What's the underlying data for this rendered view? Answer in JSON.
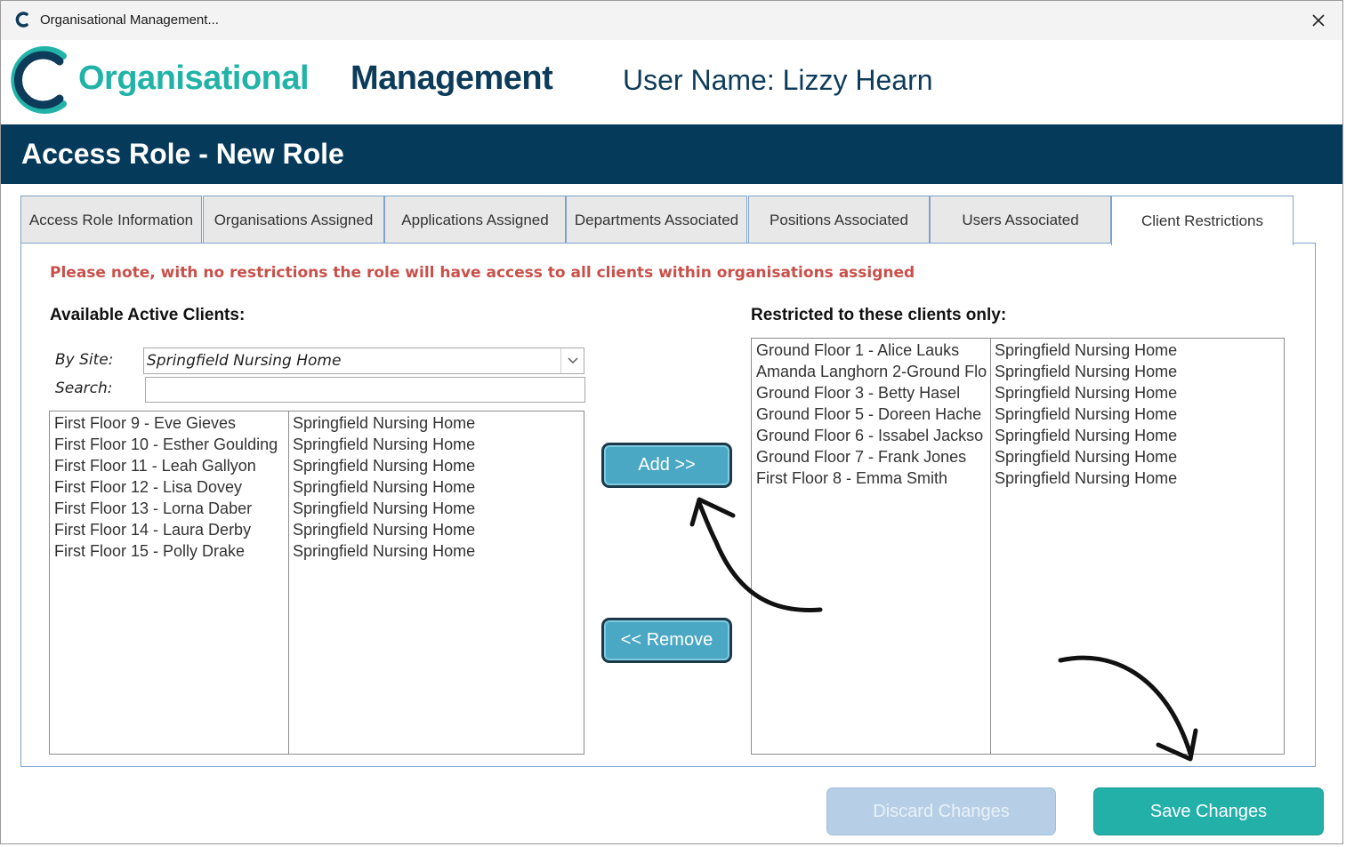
{
  "window": {
    "title": "Organisational Management...",
    "close_glyph": "✕"
  },
  "header": {
    "brand_part1": "Organisational",
    "brand_part2": "Management",
    "user_name": "User Name: Lizzy Hearn"
  },
  "banner": {
    "title": "Access Role - New Role"
  },
  "tabs": [
    {
      "label": "Access Role Information"
    },
    {
      "label": "Organisations Assigned"
    },
    {
      "label": "Applications Assigned"
    },
    {
      "label": "Departments Associated"
    },
    {
      "label": "Positions Associated"
    },
    {
      "label": "Users Associated"
    },
    {
      "label": "Client Restrictions",
      "active": true
    }
  ],
  "client_restrictions": {
    "note": "Please note, with no restrictions the role will have access to all clients within organisations assigned",
    "available_label": "Available Active Clients:",
    "restricted_label": "Restricted to these clients only:",
    "site_label": "By Site:",
    "site_value": "Springfield Nursing Home",
    "search_label": "Search:",
    "search_value": "",
    "available_clients": [
      {
        "client": "First Floor 9 - Eve Gieves",
        "site": "Springfield Nursing Home"
      },
      {
        "client": "First Floor 10 - Esther Goulding",
        "site": "Springfield Nursing Home"
      },
      {
        "client": "First Floor 11 - Leah Gallyon",
        "site": "Springfield Nursing Home"
      },
      {
        "client": "First Floor 12 - Lisa Dovey",
        "site": "Springfield Nursing Home"
      },
      {
        "client": "First Floor 13 - Lorna Daber",
        "site": "Springfield Nursing Home"
      },
      {
        "client": "First Floor 14 - Laura Derby",
        "site": "Springfield Nursing Home"
      },
      {
        "client": "First Floor 15 - Polly Drake",
        "site": "Springfield Nursing Home"
      }
    ],
    "restricted_clients": [
      {
        "client": "Ground Floor 1 - Alice Lauks",
        "site": "Springfield Nursing Home"
      },
      {
        "client": "Amanda Langhorn 2-Ground Flo",
        "site": "Springfield Nursing Home"
      },
      {
        "client": "Ground Floor 3 - Betty Hasel",
        "site": "Springfield Nursing Home"
      },
      {
        "client": "Ground Floor 5 - Doreen Hache",
        "site": "Springfield Nursing Home"
      },
      {
        "client": "Ground Floor 6 - Issabel Jackso",
        "site": "Springfield Nursing Home"
      },
      {
        "client": "Ground Floor 7 - Frank Jones",
        "site": "Springfield Nursing Home"
      },
      {
        "client": "First Floor 8 - Emma Smith",
        "site": "Springfield Nursing Home"
      }
    ],
    "add_label": "Add  >>",
    "remove_label": "<< Remove"
  },
  "footer": {
    "discard_label": "Discard Changes",
    "save_label": "Save Changes"
  },
  "colors": {
    "brand_teal": "#22b3a8",
    "brand_navy": "#0d3b5a",
    "banner": "#063a5b",
    "note_red": "#c9504a",
    "action_button": "#4ba8c4",
    "save_button": "#23b0a8",
    "discard_button_disabled": "#b7cfe6"
  },
  "icons": {
    "app": "c-logo-icon",
    "close": "close-icon",
    "dropdown": "chevron-down-icon",
    "annotations": "curved-arrow-icon"
  }
}
